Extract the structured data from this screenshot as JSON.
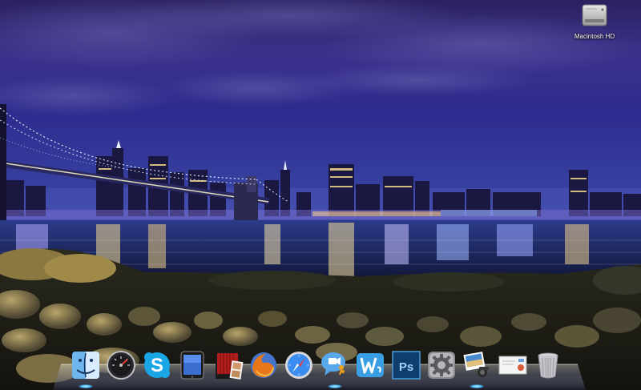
{
  "desktop": {
    "icons": [
      {
        "label": "Macintosh HD",
        "icon": "hard-drive-icon"
      }
    ]
  },
  "dock": {
    "items": [
      {
        "name": "finder",
        "icon": "finder-icon",
        "running": true
      },
      {
        "name": "dashboard",
        "icon": "dashboard-icon",
        "running": false
      },
      {
        "name": "skype",
        "icon": "skype-icon",
        "running": false
      },
      {
        "name": "ipad",
        "icon": "ipad-icon",
        "running": false
      },
      {
        "name": "photo-booth",
        "icon": "photo-booth-icon",
        "running": false
      },
      {
        "name": "firefox",
        "icon": "firefox-icon",
        "running": false
      },
      {
        "name": "safari",
        "icon": "safari-icon",
        "running": false
      },
      {
        "name": "ichat",
        "icon": "ichat-icon",
        "running": false
      },
      {
        "name": "wunderlist",
        "icon": "wunderlist-icon",
        "running": false
      },
      {
        "name": "photoshop",
        "icon": "photoshop-icon",
        "running": false,
        "text": "Ps"
      },
      {
        "name": "system-preferences",
        "icon": "system-preferences-icon",
        "running": false
      },
      {
        "name": "iphoto",
        "icon": "iphoto-icon",
        "running": true
      },
      {
        "name": "mail-document",
        "icon": "mail-document-icon",
        "running": false
      },
      {
        "name": "trash",
        "icon": "trash-icon",
        "running": false
      }
    ]
  },
  "colors": {
    "sky_top": "#3a2f86",
    "sky_horizon": "#2a2b8a",
    "water": "#1e2f6a",
    "dock_glow": "#4ab8ff",
    "photoshop_blue": "#0d3e6e"
  }
}
